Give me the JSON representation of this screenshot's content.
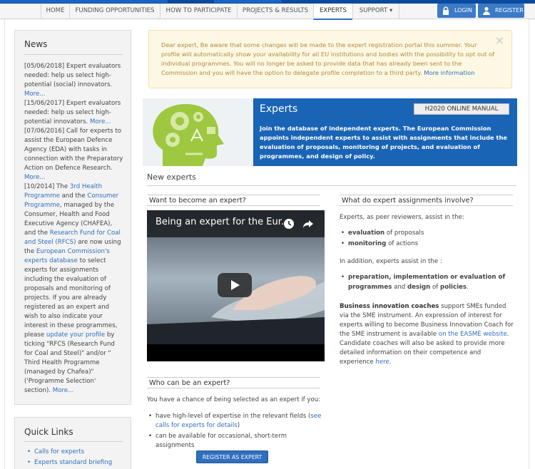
{
  "nav": {
    "items": [
      "HOME",
      "FUNDING OPPORTUNITIES",
      "HOW TO PARTICIPATE",
      "PROJECTS & RESULTS",
      "EXPERTS",
      "SUPPORT"
    ],
    "support_caret": "▾",
    "login": "LOGIN",
    "register": "REGISTER"
  },
  "news": {
    "title": "News",
    "p1": "[05/06/2018] Expert evaluators needed: help us select high-potential (social) innovators.",
    "p1_more": "More...",
    "p2": "[15/06/2017] Expert evaluators needed: help us select high-potential innovators.",
    "p2_more": "More...",
    "p3": "[07/06/2016] Call for experts to assist the European Defence Agency (EDA) with tasks in connection with the Preparatory Action on Defence Research.",
    "p3_more": "More...",
    "p4_a": "[10/2014] The ",
    "p4_link1": "3rd Health Programme",
    "p4_b": " and the ",
    "p4_link2": "Consumer Programme",
    "p4_c": ", managed by the Consumer, Health and Food Executive Agency (CHAFEA), and the ",
    "p4_link3": "Research Fund for Coal and Steel (RFCS)",
    "p4_d": " are now using the ",
    "p4_link4": "European Commission's experts database",
    "p4_e": " to select experts for assignments including the evaluation of proposals and monitoring of projects. If you are already registered as an expert and wish to also indicate your interest in these programmes, please ",
    "p4_link5": "update your profile",
    "p4_f": " by ticking \"RFCS (Research Fund for Coal and Steel)\" and/or \" Third Health Programme (managed by Chafea)\" ('Programme Selection' section). ",
    "p4_more": "More..."
  },
  "quicklinks": {
    "title": "Quick Links",
    "items": [
      "Calls for experts",
      "Experts standard briefing slides"
    ]
  },
  "alert": {
    "text": "Dear expert, Be aware that some changes will be made to the expert registration portal this summer. Your profile will automatically show your availability for all EU institutions and bodies with the possibility to opt out of individual programmes. You will no longer be asked to provide data that has already been sent to the Commission and you will have the option to delegate profile completion to a third party. ",
    "link": "More information",
    "close": "×"
  },
  "hero": {
    "title": "Experts",
    "manual": "H2020 ONLINE MANUAL",
    "desc": "Join the database of independent experts. The European Commission appoints independent experts to assist with assignments that include the evaluation of proposals, monitoring of projects, and evaluation of programmes, and design of policy."
  },
  "section_title": "New experts",
  "become": {
    "head": "Want to become an expert?",
    "video_title": "Being an expert for the Eur..."
  },
  "who": {
    "head": "Who can be an expert?",
    "intro": "You have a chance of being selected as an expert if you:",
    "b1_a": "have high-level of expertise in the relevant fields (",
    "b1_link": "see calls for experts for details",
    "b1_b": ")",
    "b2": "can be available for occasional, short-term assignments",
    "button": "REGISTER AS EXPERT"
  },
  "involve": {
    "head": "What do expert assignments involve?",
    "intro": "Experts, as peer reviewers, assist in the:",
    "b1_bold": "evaluation",
    "b1_rest": " of proposals",
    "b2_bold": "monitoring",
    "b2_rest": " of actions",
    "intro2": "In addition, experts assist in the :",
    "b3_bold1": "preparation, implementation or evaluation of programmes",
    "b3_mid": " and ",
    "b3_bold2": "design",
    "b3_mid2": " of ",
    "b3_bold3": "policies",
    "b3_end": ".",
    "bic_bold": "Business innovation coaches",
    "bic_a": " support SMEs funded via the SME instrument. An expression of interest for experts willing to become Business Innovation Coach for the SME instrument is available ",
    "bic_link1": "on the EASME website",
    "bic_b": ". Candidate coaches will also be asked to provide more detailed information on their competence and experience ",
    "bic_link2": "here",
    "bic_c": "."
  }
}
